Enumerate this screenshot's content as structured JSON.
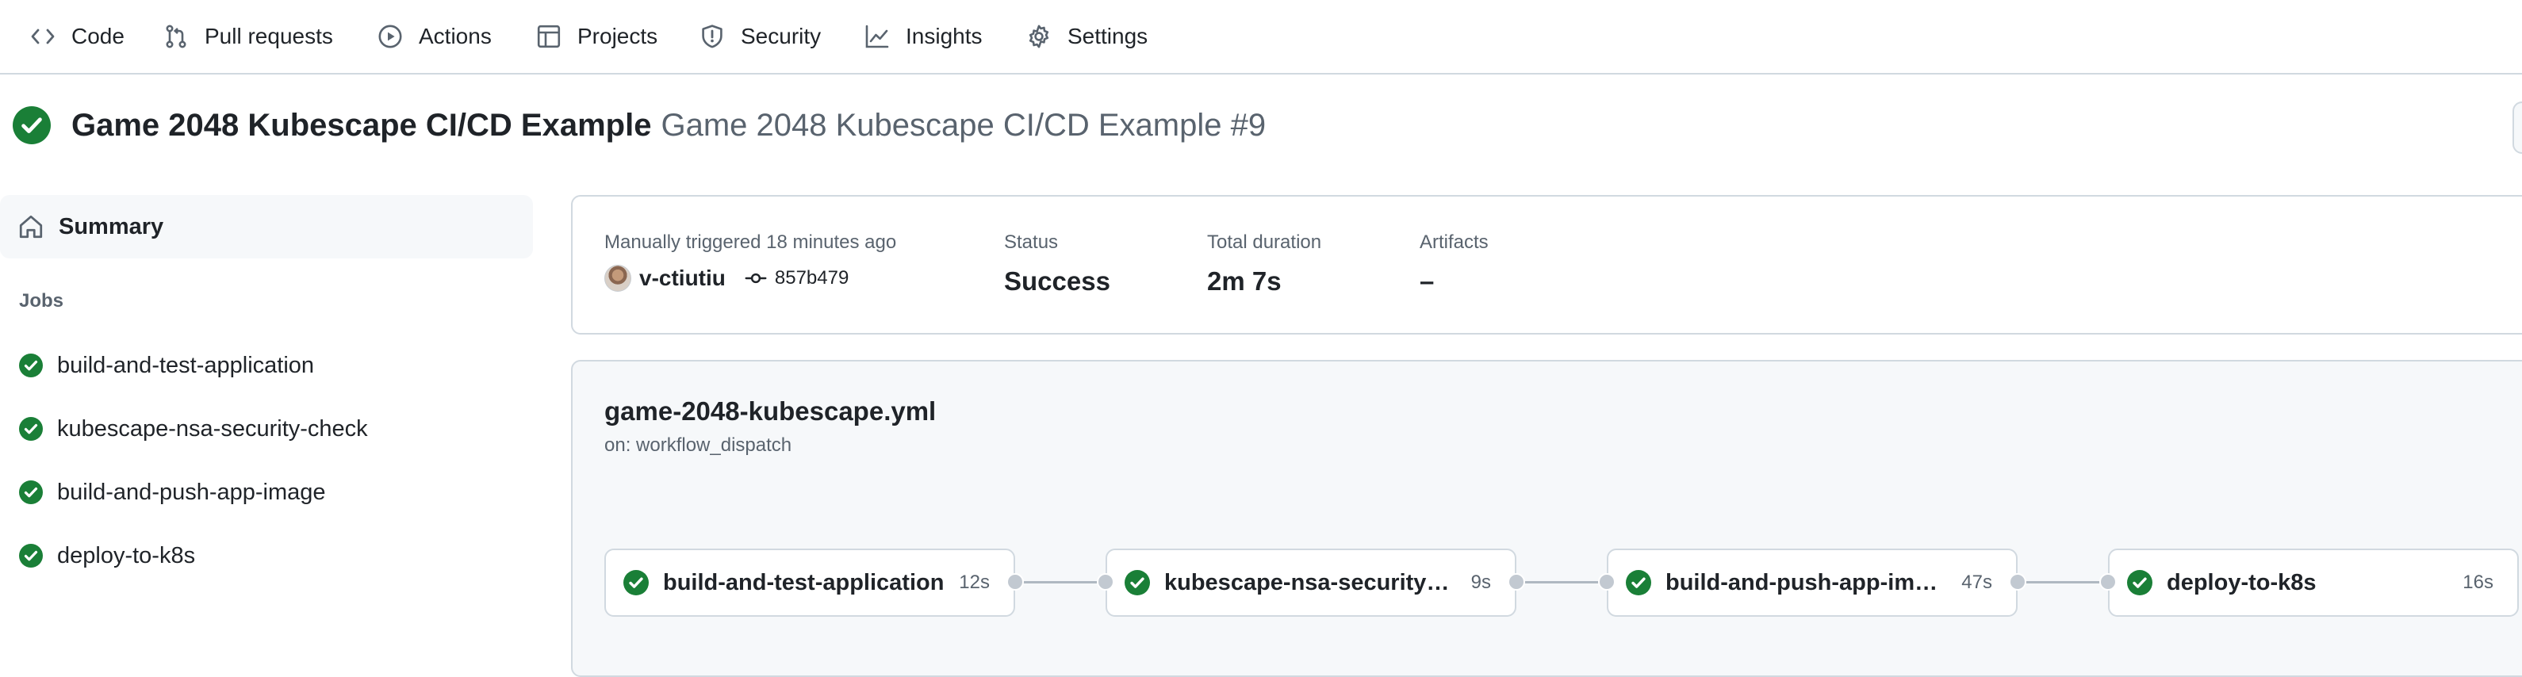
{
  "nav": {
    "tabs": [
      {
        "label": "Code",
        "icon": "code-icon"
      },
      {
        "label": "Pull requests",
        "icon": "git-pull-request-icon"
      },
      {
        "label": "Actions",
        "icon": "play-icon",
        "active": true
      },
      {
        "label": "Projects",
        "icon": "table-icon"
      },
      {
        "label": "Security",
        "icon": "shield-icon"
      },
      {
        "label": "Insights",
        "icon": "graph-icon"
      },
      {
        "label": "Settings",
        "icon": "gear-icon"
      }
    ],
    "active_underline_color": "#fd8c73"
  },
  "run": {
    "status_icon": "check-circle-icon",
    "workflow_title": "Game 2048 Kubescape CI/CD Example",
    "run_title": "Game 2048 Kubescape CI/CD Example #9"
  },
  "sidebar": {
    "summary_label": "Summary",
    "jobs_heading": "Jobs",
    "jobs": [
      {
        "name": "build-and-test-application",
        "status": "success"
      },
      {
        "name": "kubescape-nsa-security-check",
        "status": "success"
      },
      {
        "name": "build-and-push-app-image",
        "status": "success"
      },
      {
        "name": "deploy-to-k8s",
        "status": "success"
      }
    ]
  },
  "summary": {
    "trigger_text": "Manually triggered 18 minutes ago",
    "actor": "v-ctiutiu",
    "commit": "857b479",
    "status_label": "Status",
    "status_value": "Success",
    "duration_label": "Total duration",
    "duration_value": "2m 7s",
    "artifacts_label": "Artifacts",
    "artifacts_value": "–"
  },
  "workflow": {
    "file": "game-2048-kubescape.yml",
    "trigger": "on: workflow_dispatch",
    "jobs": [
      {
        "name": "build-and-test-application",
        "duration": "12s"
      },
      {
        "name": "kubescape-nsa-security-check",
        "duration": "9s"
      },
      {
        "name": "build-and-push-app-image",
        "duration": "47s"
      },
      {
        "name": "deploy-to-k8s",
        "duration": "16s"
      }
    ]
  },
  "colors": {
    "success": "#1a7f37",
    "border": "#d1d9e0",
    "muted_text": "#59636e",
    "panel_bg": "#f6f8fa"
  }
}
